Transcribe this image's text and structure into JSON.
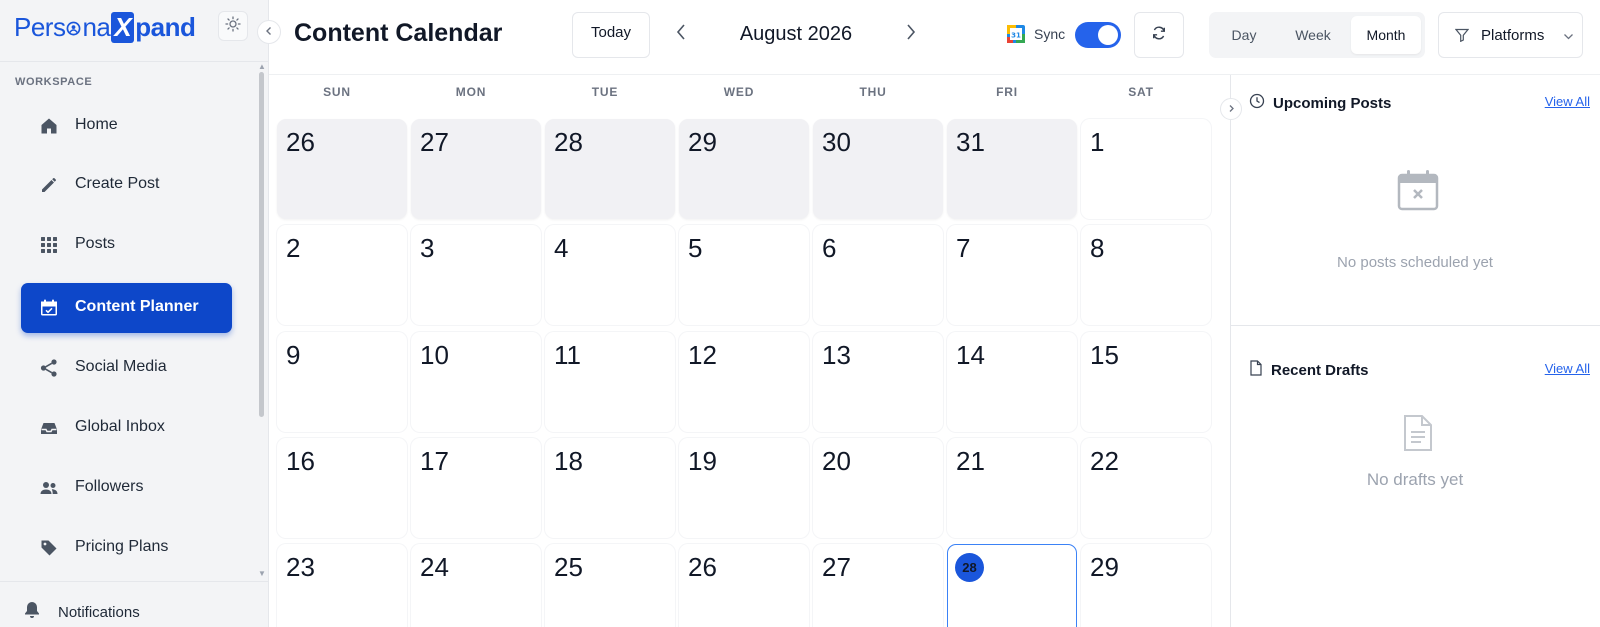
{
  "brand": {
    "part1": "Pers",
    "part1b": "na",
    "x": "X",
    "part2": "pand"
  },
  "sidebar": {
    "section_label": "WORKSPACE",
    "items": [
      {
        "label": "Home",
        "icon": "home-icon",
        "active": false
      },
      {
        "label": "Create Post",
        "icon": "pencil-icon",
        "active": false
      },
      {
        "label": "Posts",
        "icon": "grid-icon",
        "active": false
      },
      {
        "label": "Content Planner",
        "icon": "calendar-check-icon",
        "active": true
      },
      {
        "label": "Social Media",
        "icon": "share-icon",
        "active": false
      },
      {
        "label": "Global Inbox",
        "icon": "inbox-icon",
        "active": false
      },
      {
        "label": "Followers",
        "icon": "users-icon",
        "active": false
      },
      {
        "label": "Pricing Plans",
        "icon": "tag-icon",
        "active": false
      }
    ],
    "notifications_label": "Notifications"
  },
  "header": {
    "title": "Content Calendar",
    "today_label": "Today",
    "month_label": "August 2026",
    "sync_label": "Sync",
    "sync_enabled": true,
    "views": [
      "Day",
      "Week",
      "Month"
    ],
    "active_view": "Month",
    "platforms_label": "Platforms"
  },
  "calendar": {
    "weekdays": [
      "SUN",
      "MON",
      "TUE",
      "WED",
      "THU",
      "FRI",
      "SAT"
    ],
    "weeks": [
      [
        {
          "d": "26",
          "other": true
        },
        {
          "d": "27",
          "other": true
        },
        {
          "d": "28",
          "other": true
        },
        {
          "d": "29",
          "other": true
        },
        {
          "d": "30",
          "other": true
        },
        {
          "d": "31",
          "other": true
        },
        {
          "d": "1"
        }
      ],
      [
        {
          "d": "2"
        },
        {
          "d": "3"
        },
        {
          "d": "4"
        },
        {
          "d": "5"
        },
        {
          "d": "6"
        },
        {
          "d": "7"
        },
        {
          "d": "8"
        }
      ],
      [
        {
          "d": "9"
        },
        {
          "d": "10"
        },
        {
          "d": "11"
        },
        {
          "d": "12"
        },
        {
          "d": "13"
        },
        {
          "d": "14"
        },
        {
          "d": "15"
        }
      ],
      [
        {
          "d": "16"
        },
        {
          "d": "17"
        },
        {
          "d": "18"
        },
        {
          "d": "19"
        },
        {
          "d": "20"
        },
        {
          "d": "21"
        },
        {
          "d": "22"
        }
      ],
      [
        {
          "d": "23"
        },
        {
          "d": "24"
        },
        {
          "d": "25"
        },
        {
          "d": "26"
        },
        {
          "d": "27"
        },
        {
          "d": "28",
          "today": true
        },
        {
          "d": "29"
        }
      ]
    ]
  },
  "panel": {
    "upcoming": {
      "title": "Upcoming Posts",
      "view_all": "View All",
      "empty": "No posts scheduled yet"
    },
    "drafts": {
      "title": "Recent Drafts",
      "view_all": "View All",
      "empty": "No drafts yet"
    }
  },
  "colors": {
    "accent": "#0d47c9",
    "toggle": "#2563eb",
    "today_circle": "#1a56db"
  }
}
